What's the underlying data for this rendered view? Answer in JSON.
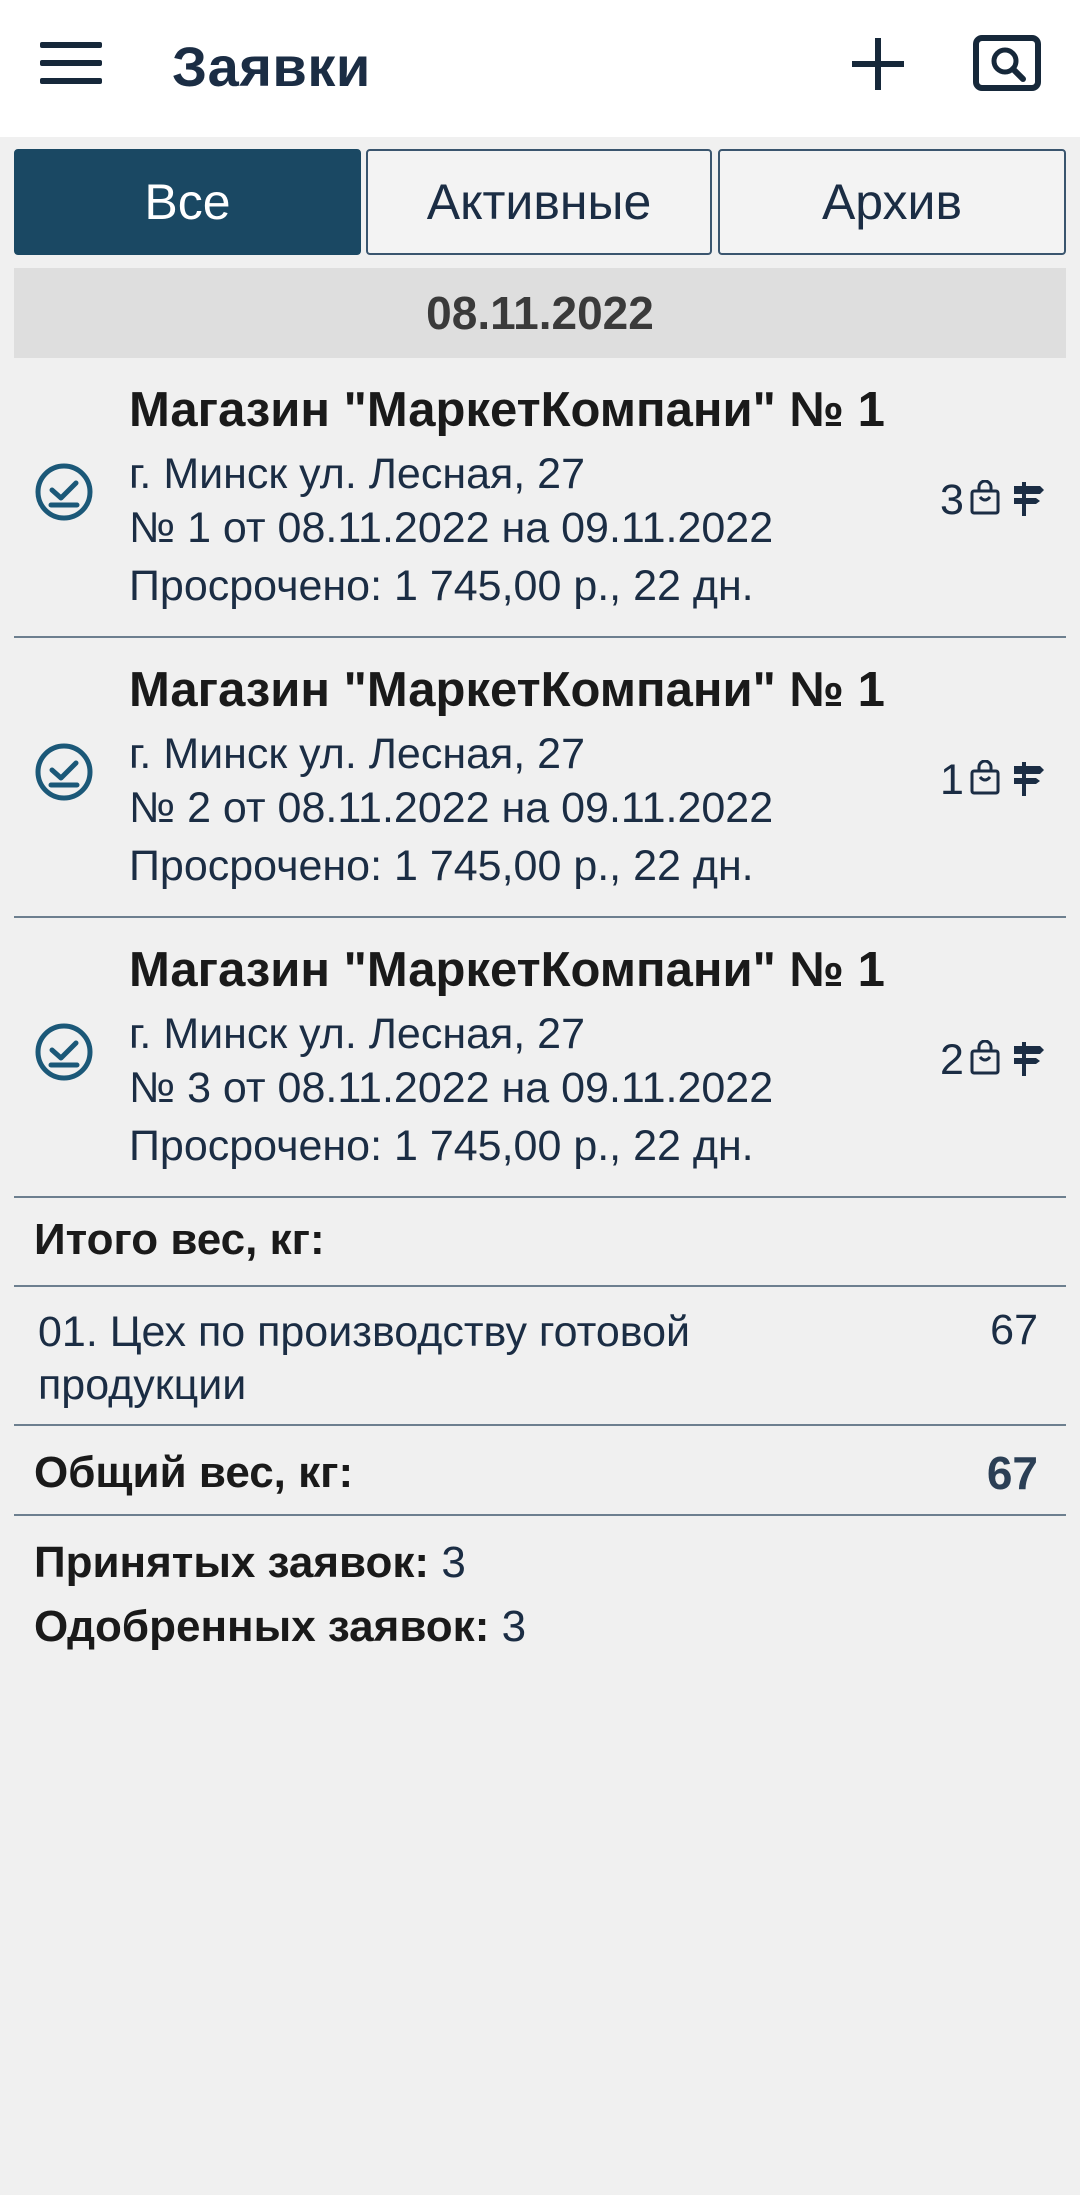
{
  "app": {
    "title": "Заявки"
  },
  "tabs": [
    {
      "label": "Все",
      "active": true
    },
    {
      "label": "Активные",
      "active": false
    },
    {
      "label": "Архив",
      "active": false
    }
  ],
  "date_group": "08.11.2022",
  "orders": [
    {
      "title": "Магазин \"МаркетКомпани\" № 1",
      "address": "г. Минск ул. Лесная, 27",
      "number": "№ 1 от 08.11.2022 на 09.11.2022",
      "overdue": "Просрочено: 1 745,00 р., 22 дн.",
      "count": "3",
      "status_icon": "check-circle-icon"
    },
    {
      "title": "Магазин \"МаркетКомпани\" № 1",
      "address": "г. Минск ул. Лесная, 27",
      "number": "№ 2 от 08.11.2022 на 09.11.2022",
      "overdue": "Просрочено: 1 745,00 р., 22 дн.",
      "count": "1",
      "status_icon": "check-circle-icon"
    },
    {
      "title": "Магазин \"МаркетКомпани\" № 1",
      "address": "г. Минск ул. Лесная, 27",
      "number": "№ 3 от 08.11.2022 на 09.11.2022",
      "overdue": "Просрочено: 1 745,00 р., 22 дн.",
      "count": "2",
      "status_icon": "check-circle-icon"
    }
  ],
  "totals": {
    "title": "Итого вес, кг:",
    "workshops": [
      {
        "name": "01. Цех по производству готовой продукции",
        "value": "67"
      }
    ],
    "total_label": "Общий вес, кг:",
    "total_value": "67"
  },
  "stats": {
    "accepted_label": "Принятых заявок:",
    "accepted_value": "3",
    "approved_label": "Одобренных заявок:",
    "approved_value": "3"
  },
  "colors": {
    "primary": "#1a4863",
    "icon": "#1b5878",
    "text": "#1b2d44",
    "background": "#f0f0f0"
  }
}
